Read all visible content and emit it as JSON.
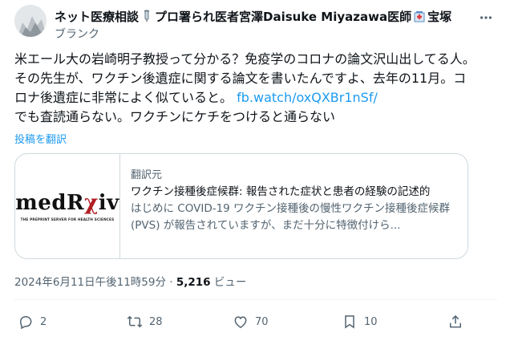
{
  "author": {
    "name_part1": "ネット医療相談",
    "name_part2": "プロ署られ医者宮澤Daisuke Miyazawa医師",
    "name_part3": "宝塚",
    "handle": "ブランク"
  },
  "tweet": {
    "text_before_link": "米エール大の岩崎明子教授って分かる？免疫学のコロナの論文沢山出してる人。 その先生が、ワクチン後遺症に関する論文を書いたんですよ、去年の11月。コロナ後遺症に非常によく似ていると。",
    "link": "fb.watch/oxQXBr1nSf/",
    "text_after_link": "でも査読通らない。ワクチンにケチをつけると通らない",
    "translate_label": "投稿を翻訳"
  },
  "card": {
    "logo_text_main": "medR",
    "logo_text_r": "χ",
    "logo_text_end": "iv",
    "logo_subtitle": "THE PREPRINT SERVER FOR HEALTH SCIENCES",
    "domain": "翻訳元",
    "title": "ワクチン接種後症候群: 報告された症状と患者の経験の記述的",
    "description": "はじめに COVID-19 ワクチン接種後の慢性ワクチン接種後症候群 (PVS) が報告されていますが、まだ十分に特徴付けら..."
  },
  "meta": {
    "timestamp": "2024年6月11日午後11時59分",
    "separator": " · ",
    "views_count": "5,216",
    "views_label": " ビュー"
  },
  "actions": {
    "replies": "2",
    "reposts": "28",
    "likes": "70",
    "bookmarks": "10"
  },
  "colors": {
    "accent": "#1d9bf0",
    "secondary_text": "#536471",
    "border": "#cfd9de"
  }
}
